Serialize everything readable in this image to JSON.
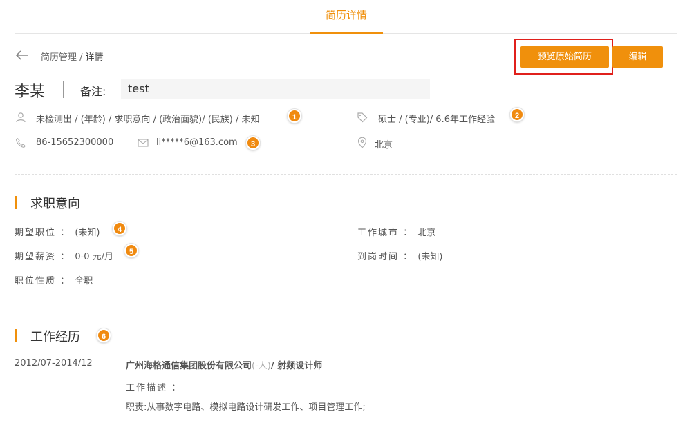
{
  "tabs": {
    "active_label": "简历详情"
  },
  "breadcrumb": {
    "parent": "简历管理",
    "separator": " / ",
    "current": "详情"
  },
  "actions": {
    "preview_label": "预览原始简历",
    "edit_label": "编辑"
  },
  "profile": {
    "name": "李某",
    "remark_label": "备注:",
    "remark_value": "test",
    "basic_info": "未检测出 / (年龄) / 求职意向 / (政治面貌)/ (民族) / 未知",
    "education": "硕士 / (专业)/ 6.6年工作经验",
    "phone": "86-15652300000",
    "email": "li*****6@163.com",
    "location": "北京"
  },
  "badges": [
    "1",
    "2",
    "3",
    "4",
    "5",
    "6"
  ],
  "job_intention": {
    "title": "求职意向",
    "fields": [
      {
        "label": "期望职位",
        "sep": "：",
        "value": "(未知)"
      },
      {
        "label": "工作城市",
        "sep": "：",
        "value": "北京"
      },
      {
        "label": "期望薪资",
        "sep": "：",
        "value": "0-0 元/月"
      },
      {
        "label": "到岗时间",
        "sep": "：",
        "value": "(未知)"
      },
      {
        "label": "职位性质",
        "sep": "：",
        "value": "全职"
      }
    ]
  },
  "work_experience": {
    "title": "工作经历",
    "items": [
      {
        "date": "2012/07-2014/12",
        "company": "广州海格通信集团股份有限公司",
        "size": "(-人)",
        "position_sep": "/ ",
        "position": "射频设计师",
        "desc_label": "工作描述 ：",
        "desc": "职责:从事数字电路、模拟电路设计研发工作、项目管理工作;"
      }
    ]
  },
  "colors": {
    "accent": "#f0900c",
    "highlight": "#e0201c",
    "badge": "#f08a10"
  }
}
